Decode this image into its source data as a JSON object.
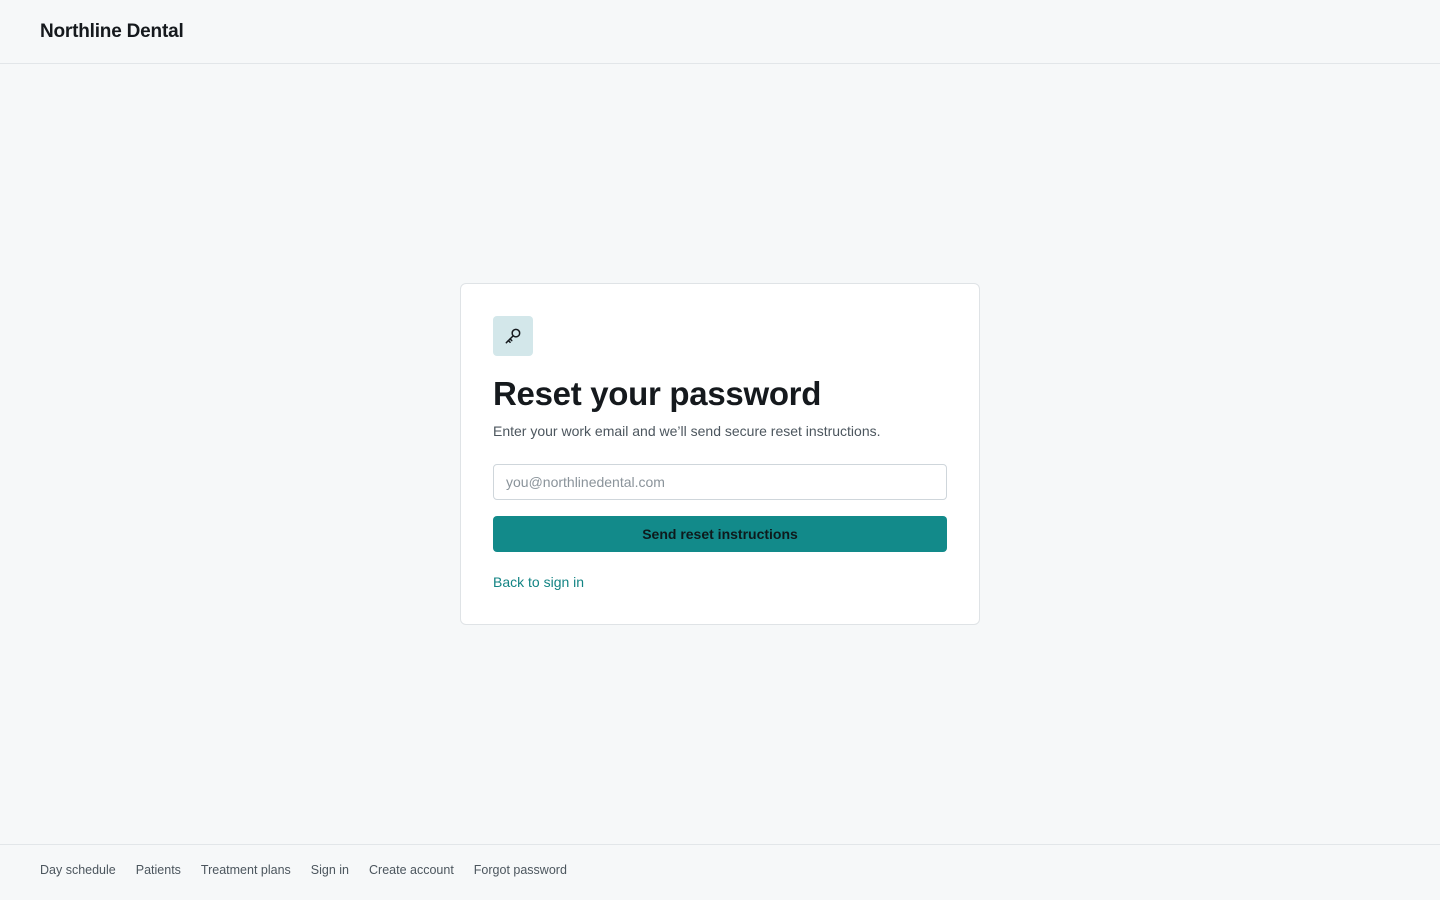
{
  "header": {
    "brand": "Northline Dental"
  },
  "reset_card": {
    "icon": "key-icon",
    "title": "Reset your password",
    "subtitle": "Enter your work email and we’ll send secure reset instructions.",
    "email_input": {
      "value": "",
      "placeholder": "you@northlinedental.com"
    },
    "submit_label": "Send reset instructions",
    "back_link_label": "Back to sign in"
  },
  "footer": {
    "links": [
      {
        "label": "Day schedule"
      },
      {
        "label": "Patients"
      },
      {
        "label": "Treatment plans"
      },
      {
        "label": "Sign in"
      },
      {
        "label": "Create account"
      },
      {
        "label": "Forgot password"
      }
    ]
  },
  "colors": {
    "accent": "#128a8a",
    "link": "#138484",
    "icon_background": "#d3e7ea",
    "page_background": "#f6f8f9"
  }
}
